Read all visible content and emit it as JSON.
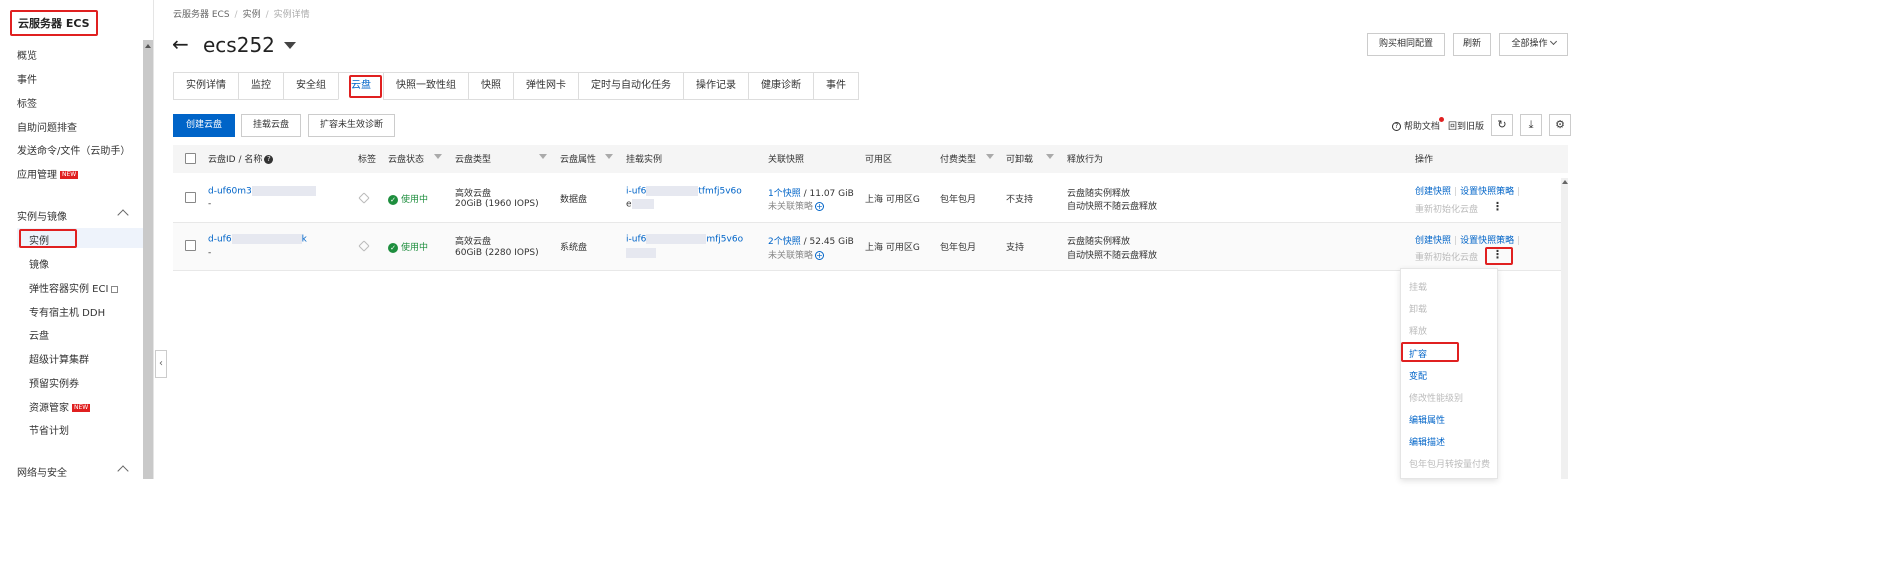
{
  "sidebar": {
    "title": "云服务器 ECS",
    "top_items": [
      "概览",
      "事件",
      "标签",
      "自助问题排查",
      "发送命令/文件（云助手）",
      "应用管理"
    ],
    "new_badge": "NEW",
    "group1": "实例与镜像",
    "group1_items": [
      "实例",
      "镜像",
      "弹性容器实例 ECI",
      "专有宿主机 DDH",
      "云盘",
      "超级计算集群",
      "预留实例券",
      "资源管家",
      "节省计划"
    ],
    "group2": "网络与安全",
    "collapse_glyph": "‹"
  },
  "breadcrumb": [
    "云服务器 ECS",
    "实例",
    "实例详情"
  ],
  "breadcrumb_sep": "/",
  "header": {
    "back_glyph": "←",
    "title": "ecs252",
    "buy_same": "购买相同配置",
    "refresh": "刷新",
    "all_ops": "全部操作"
  },
  "tabs": [
    "实例详情",
    "监控",
    "安全组",
    "云盘",
    "快照一致性组",
    "快照",
    "弹性网卡",
    "定时与自动化任务",
    "操作记录",
    "健康诊断",
    "事件"
  ],
  "active_tab": "云盘",
  "toolbar": {
    "create_disk": "创建云盘",
    "attach_disk": "挂载云盘",
    "expand_diag": "扩容未生效诊断",
    "help_doc": "帮助文档",
    "help_glyph": "?",
    "back_old": "回到旧版",
    "refresh_icon": "↻",
    "download_icon": "⤓",
    "settings_icon": "⚙"
  },
  "table": {
    "columns": {
      "id_name": "云盘ID / 名称",
      "tag": "标签",
      "status": "云盘状态",
      "type": "云盘类型",
      "attr": "云盘属性",
      "instance": "挂载实例",
      "snapshot": "关联快照",
      "zone": "可用区",
      "billing": "付费类型",
      "detachable": "可卸载",
      "release": "释放行为",
      "ops": "操作"
    },
    "help_glyph": "?",
    "status_glyph": "✓",
    "plus_glyph": "+",
    "more_glyph": "⋮",
    "rows": [
      {
        "id_prefix": "d-uf60m3",
        "id_suffix": "",
        "name": "-",
        "status": "使用中",
        "type": "高效云盘",
        "type_spec": "20GiB (1960 IOPS)",
        "attr": "数据盘",
        "instance_prefix": "i-uf6",
        "instance_suffix": "tfmfj5v6o",
        "instance_line2": "e",
        "snapshot_link": "1个快照",
        "snapshot_size": "/ 11.07 GiB",
        "snapshot_policy": "未关联策略",
        "zone": "上海 可用区G",
        "billing": "包年包月",
        "detachable": "不支持",
        "release1": "云盘随实例释放",
        "release2": "自动快照不随云盘释放",
        "op1": "创建快照",
        "op2": "设置快照策略",
        "op3": "重新初始化云盘"
      },
      {
        "id_prefix": "d-uf6",
        "id_suffix": "k",
        "name": "-",
        "status": "使用中",
        "type": "高效云盘",
        "type_spec": "60GiB (2280 IOPS)",
        "attr": "系统盘",
        "instance_prefix": "i-uf6",
        "instance_suffix": "mfj5v6o",
        "instance_line2": "",
        "snapshot_link": "2个快照",
        "snapshot_size": "/ 52.45 GiB",
        "snapshot_policy": "未关联策略",
        "zone": "上海 可用区G",
        "billing": "包年包月",
        "detachable": "支持",
        "release1": "云盘随实例释放",
        "release2": "自动快照不随云盘释放",
        "op1": "创建快照",
        "op2": "设置快照策略",
        "op3": "重新初始化云盘"
      }
    ]
  },
  "dropdown": {
    "items": [
      {
        "label": "挂载",
        "enabled": false
      },
      {
        "label": "卸载",
        "enabled": false
      },
      {
        "label": "释放",
        "enabled": false
      },
      {
        "label": "扩容",
        "enabled": true
      },
      {
        "label": "变配",
        "enabled": true
      },
      {
        "label": "修改性能级别",
        "enabled": false
      },
      {
        "label": "编辑属性",
        "enabled": true
      },
      {
        "label": "编辑描述",
        "enabled": true
      },
      {
        "label": "包年包月转按量付费",
        "enabled": false
      }
    ]
  },
  "colors": {
    "accent": "#0064c8",
    "highlight": "#e02020",
    "success": "#1e8e3e"
  }
}
